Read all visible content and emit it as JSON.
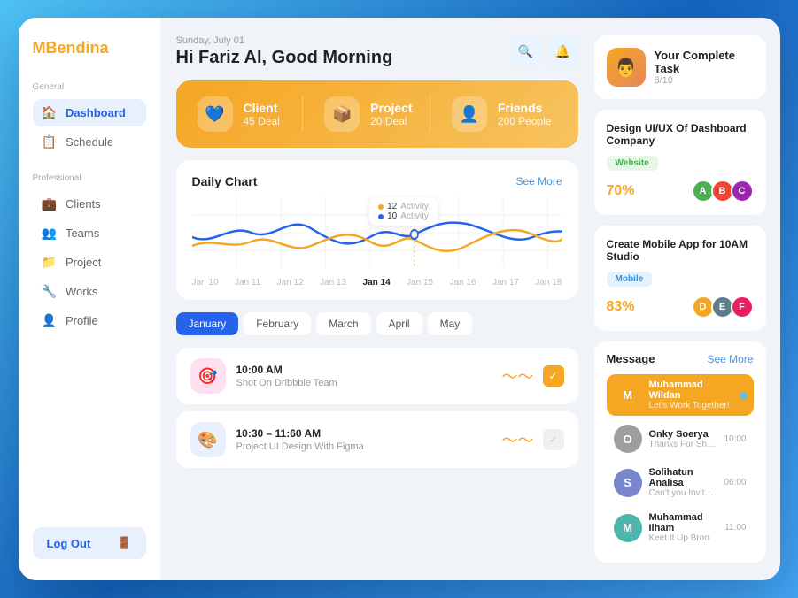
{
  "app": {
    "logo_prefix": "MB",
    "logo_suffix": "endina"
  },
  "sidebar": {
    "general_label": "General",
    "professional_label": "Professional",
    "items_general": [
      {
        "id": "dashboard",
        "label": "Dashboard",
        "icon": "🏠",
        "active": true
      },
      {
        "id": "schedule",
        "label": "Schedule",
        "icon": "📋",
        "active": false
      }
    ],
    "items_professional": [
      {
        "id": "clients",
        "label": "Clients",
        "icon": "💼",
        "active": false
      },
      {
        "id": "teams",
        "label": "Teams",
        "icon": "👥",
        "active": false
      },
      {
        "id": "project",
        "label": "Project",
        "icon": "📁",
        "active": false
      },
      {
        "id": "works",
        "label": "Works",
        "icon": "🔧",
        "active": false
      },
      {
        "id": "profile",
        "label": "Profile",
        "icon": "👤",
        "active": false
      }
    ],
    "logout_label": "Log Out"
  },
  "header": {
    "date": "Sunday, July 01",
    "greeting": "Hi Fariz Al, Good Morning"
  },
  "stats": [
    {
      "label": "Client",
      "value": "45 Deal",
      "icon": "💙"
    },
    {
      "label": "Project",
      "value": "20 Deal",
      "icon": "📦"
    },
    {
      "label": "Friends",
      "value": "200 People",
      "icon": "👤"
    }
  ],
  "chart": {
    "title": "Daily Chart",
    "see_more": "See More",
    "tooltip": {
      "activity1": {
        "count": "12",
        "label": "Activity"
      },
      "activity2": {
        "count": "10",
        "label": "Activity"
      }
    },
    "labels": [
      "Jan 10",
      "Jan 11",
      "Jan 12",
      "Jan 13",
      "Jan 14",
      "Jan 15",
      "Jan 16",
      "Jan 17",
      "Jan 18"
    ]
  },
  "months": [
    {
      "label": "January",
      "active": true
    },
    {
      "label": "February",
      "active": false
    },
    {
      "label": "March",
      "active": false
    },
    {
      "label": "April",
      "active": false
    },
    {
      "label": "May",
      "active": false
    }
  ],
  "schedule": [
    {
      "time": "10:00 AM",
      "name": "Shot On Dribbble Team",
      "icon_bg": "#ffe0f0",
      "icon": "🎯",
      "done": true
    },
    {
      "time": "10:30 – 11:60 AM",
      "name": "Project UI Design With Figma",
      "icon_bg": "#e8f0ff",
      "icon": "🎨",
      "done": false
    }
  ],
  "right_panel": {
    "task_title": "Your Complete Task",
    "task_count": "8/10",
    "user_emoji": "👨",
    "tasks": [
      {
        "title": "Design UI/UX Of Dashboard Company",
        "tag": "Website",
        "tag_class": "tag-website",
        "percent": "70%",
        "avatars": [
          {
            "color": "#4caf50",
            "initial": "A"
          },
          {
            "color": "#f44336",
            "initial": "B"
          },
          {
            "color": "#9c27b0",
            "initial": "C"
          }
        ]
      },
      {
        "title": "Create Mobile App for 10AM Studio",
        "tag": "Mobile",
        "tag_class": "tag-mobile",
        "percent": "83%",
        "avatars": [
          {
            "color": "#f5a623",
            "initial": "D"
          },
          {
            "color": "#607d8b",
            "initial": "E"
          },
          {
            "color": "#e91e63",
            "initial": "F"
          }
        ]
      }
    ]
  },
  "messages": {
    "title": "Message",
    "see_more": "See More",
    "items": [
      {
        "name": "Muhammad Wildan",
        "preview": "Let's Work Together!",
        "time": "",
        "active": true,
        "avatar_color": "#f5a623",
        "initial": "M",
        "online": true
      },
      {
        "name": "Onky Soerya",
        "preview": "Thanks For Sharing",
        "time": "10:00",
        "active": false,
        "avatar_color": "#9e9e9e",
        "initial": "O",
        "online": false
      },
      {
        "name": "Solihatun Analisa",
        "preview": "Can't you Invite on figma",
        "time": "06:00",
        "active": false,
        "avatar_color": "#7986cb",
        "initial": "S",
        "online": false
      },
      {
        "name": "Muhammad Ilham",
        "preview": "Keet It Up Broo",
        "time": "11:00",
        "active": false,
        "avatar_color": "#4db6ac",
        "initial": "M",
        "online": false
      }
    ]
  }
}
